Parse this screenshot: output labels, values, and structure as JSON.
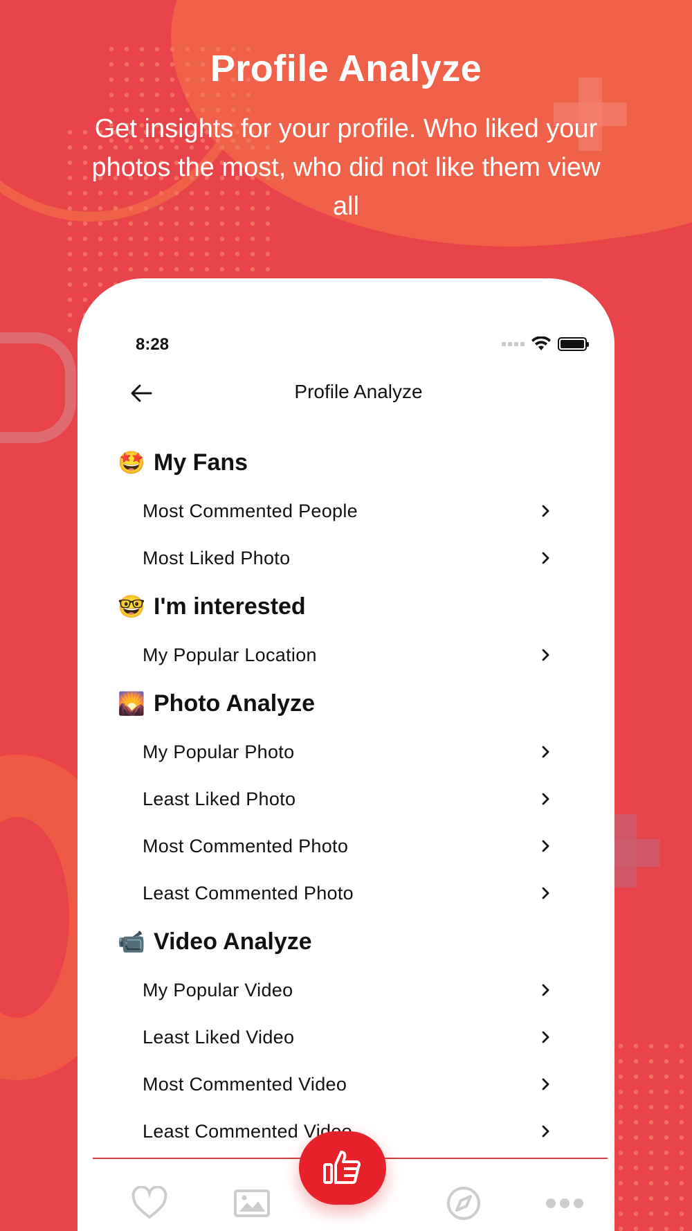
{
  "hero": {
    "title": "Profile Analyze",
    "subtitle": "Get insights for your profile. Who liked your photos the most, who did not like them view all"
  },
  "status_bar": {
    "time": "8:28"
  },
  "navbar": {
    "title": "Profile Analyze",
    "back_icon": "arrow-left-icon"
  },
  "sections": [
    {
      "emoji": "🤩",
      "title": "My Fans",
      "items": [
        "Most Commented People",
        "Most Liked Photo"
      ]
    },
    {
      "emoji": "🤓",
      "title": "I'm interested",
      "items": [
        "My Popular Location"
      ]
    },
    {
      "emoji": "🌄",
      "title": "Photo Analyze",
      "items": [
        "My Popular Photo",
        "Least Liked Photo",
        "Most Commented Photo",
        "Least Commented Photo"
      ]
    },
    {
      "emoji": "📹",
      "title": "Video Analyze",
      "items": [
        "My Popular Video",
        "Least Liked Video",
        "Most Commented Video",
        "Least Commented Video"
      ]
    }
  ],
  "tabbar": {
    "tabs": [
      "heart-icon",
      "image-icon",
      "thumbs-up-icon",
      "compass-icon",
      "more-icon"
    ]
  },
  "colors": {
    "accent": "#e8222a",
    "background": "#e9434a"
  }
}
